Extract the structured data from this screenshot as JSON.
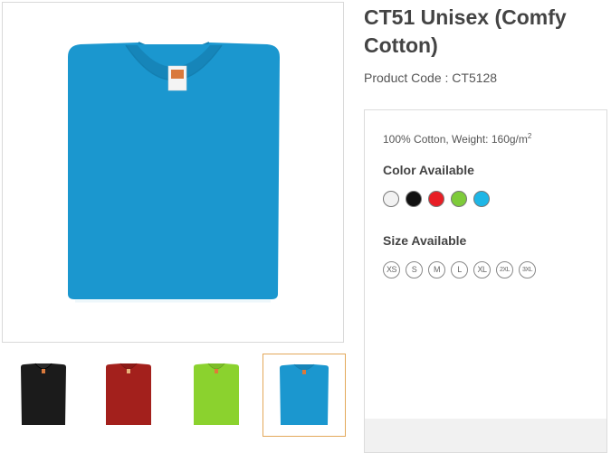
{
  "product": {
    "title": "CT51 Unisex (Comfy Cotton)",
    "code_label": "Product Code : CT5128"
  },
  "main_image": {
    "color": "#1b97cf",
    "label_tag": "shirt-label"
  },
  "thumbnails": [
    {
      "name": "black",
      "color": "#1b1b1b",
      "active": false
    },
    {
      "name": "red",
      "color": "#a3201c",
      "active": false
    },
    {
      "name": "lime",
      "color": "#8bd22e",
      "active": false
    },
    {
      "name": "blue",
      "color": "#1b97cf",
      "active": true
    }
  ],
  "details": {
    "spec_text": "100% Cotton, Weight: 160g/m",
    "spec_sup": "2",
    "color_heading": "Color Available",
    "colors": [
      "#f2f2f2",
      "#111111",
      "#e81e25",
      "#7ecb3a",
      "#1eb6e6"
    ],
    "size_heading": "Size Available",
    "sizes": [
      "XS",
      "S",
      "M",
      "L",
      "XL",
      "2XL",
      "3XL"
    ]
  }
}
